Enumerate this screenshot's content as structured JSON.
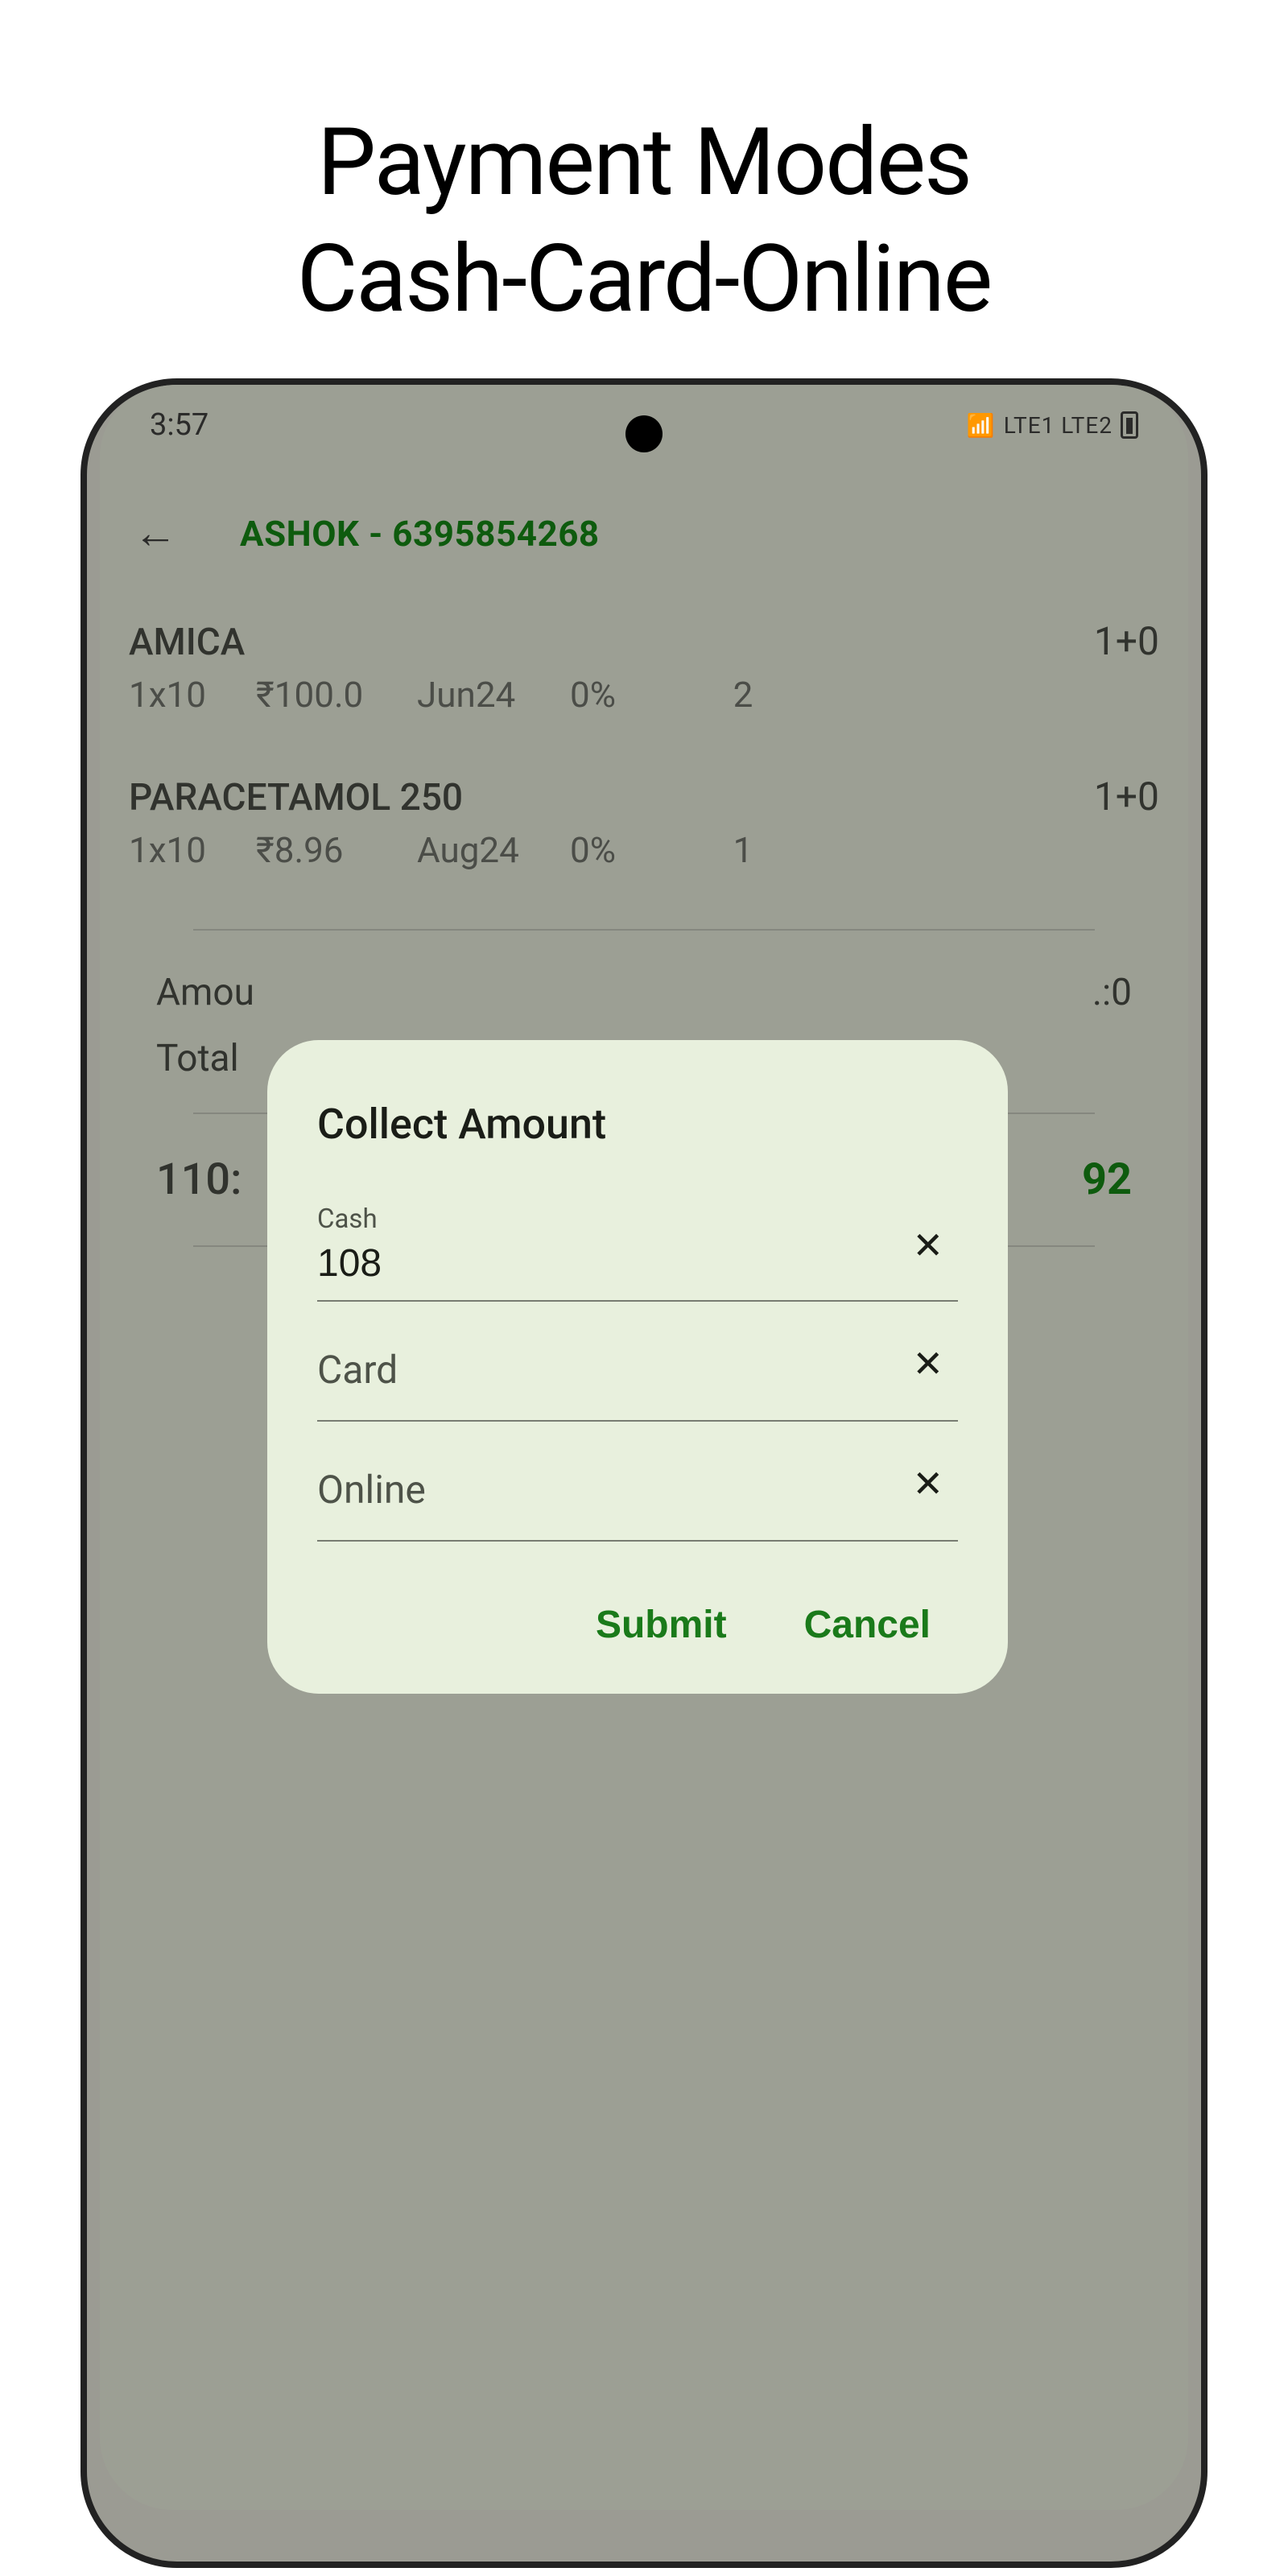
{
  "page_heading_line1": "Payment Modes",
  "page_heading_line2": "Cash-Card-Online",
  "status": {
    "time": "3:57",
    "right_indicators": "LTE1   LTE2"
  },
  "header": {
    "title": "ASHOK - 6395854268"
  },
  "items": [
    {
      "name": "AMICA",
      "qty_label": "1+0",
      "pack": "1x10",
      "price": "₹100.0",
      "expiry": "Jun24",
      "discount": "0%",
      "qty": "2"
    },
    {
      "name": "PARACETAMOL 250",
      "qty_label": "1+0",
      "pack": "1x10",
      "price": "₹8.96",
      "expiry": "Aug24",
      "discount": "0%",
      "qty": "1"
    }
  ],
  "summary": {
    "amount_label": "Amou",
    "amount_right_fragment": ".:0",
    "total_label": "Total"
  },
  "bottom_total": {
    "left": "110:",
    "right": "92"
  },
  "dialog": {
    "title": "Collect Amount",
    "cash_label": "Cash",
    "cash_value": "108",
    "card_label": "Card",
    "online_label": "Online",
    "submit": "Submit",
    "cancel": "Cancel"
  }
}
